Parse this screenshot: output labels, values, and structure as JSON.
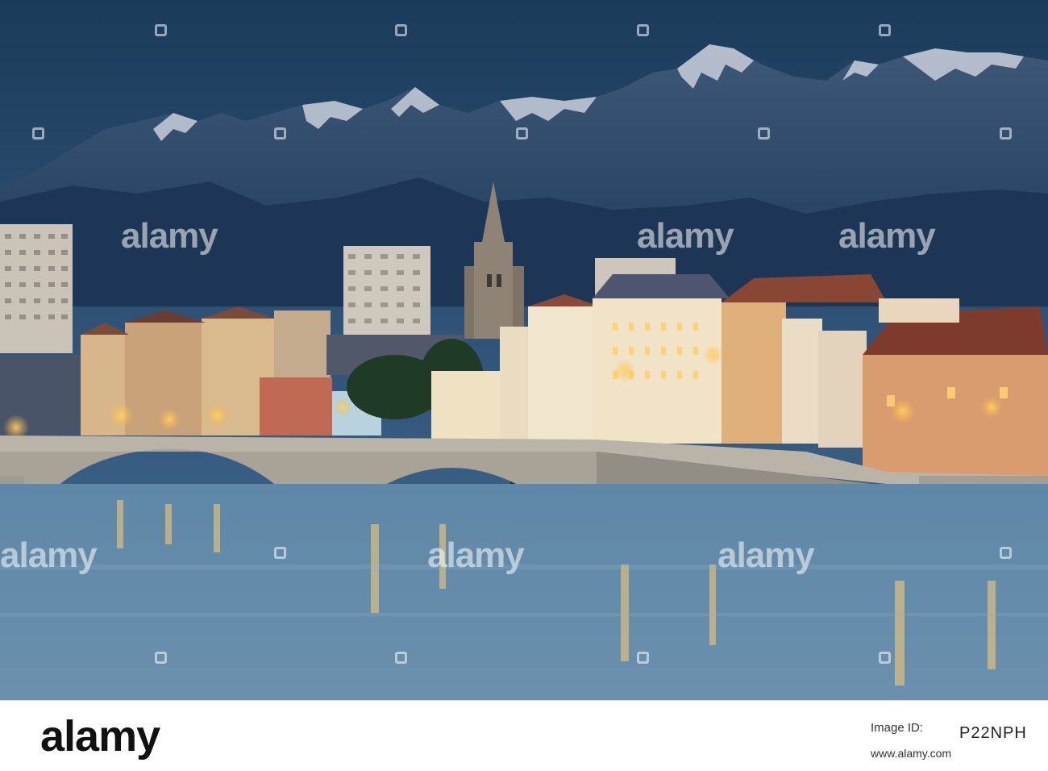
{
  "watermark": {
    "text": "alamy",
    "color": "#ffffff"
  },
  "footer": {
    "brand": "alamy",
    "image_id_label": "Image ID:",
    "image_id": "P22NPH",
    "site": "www.alamy.com"
  },
  "scene": {
    "sky_top": "#1b3b5a",
    "sky_bottom": "#3a5f85",
    "mountain_snow": "#dcdfe8",
    "water": "#5f87a7",
    "lights": "#ffb93d"
  }
}
